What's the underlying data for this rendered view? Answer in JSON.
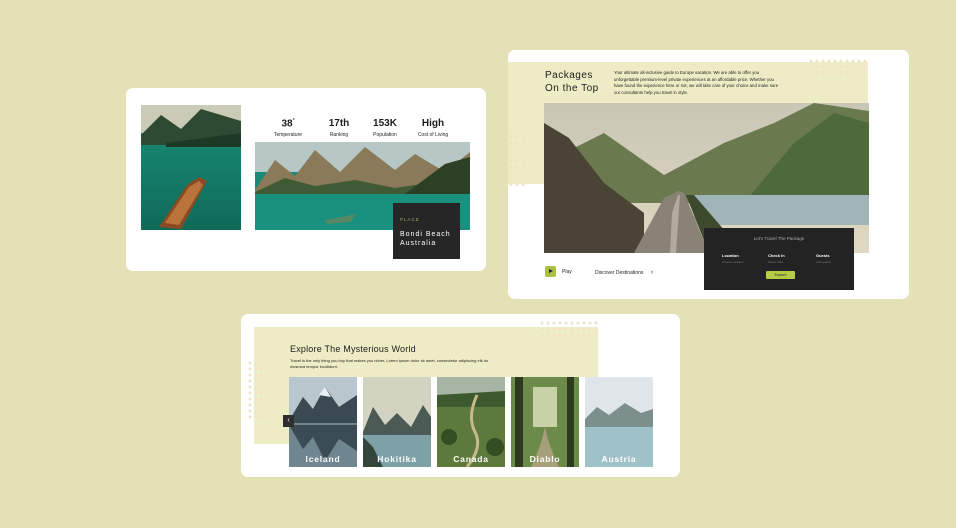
{
  "card1": {
    "stats": [
      {
        "value": "38",
        "unit": "°",
        "label": "Temperature"
      },
      {
        "value": "17th",
        "unit": "",
        "label": "Ranking"
      },
      {
        "value": "153K",
        "unit": "",
        "label": "Population"
      },
      {
        "value": "High",
        "unit": "",
        "label": "Cost of Living"
      }
    ],
    "place_kicker": "PLACE",
    "place_name": "Bondi Beach Australia"
  },
  "card2": {
    "title": "Packages On the Top",
    "description": "Your ultimate all-inclusive guide to Europe vacation. We are able to offer you unforgettable premium-level private experiences at an affordable price. Whether you have found the experience here or not, we will take care of your choice and make sure our consultants help you travel in style.",
    "play_label": "Play",
    "discover_label": "Discover Destinations",
    "discover_arrow": "›",
    "booking": {
      "heading": "Let's Travel The Package",
      "columns": [
        {
          "label": "Location",
          "hint": "Choose location"
        },
        {
          "label": "Check In",
          "hint": "Select date"
        },
        {
          "label": "Guests",
          "hint": "Add guests"
        }
      ],
      "button": "Explore"
    }
  },
  "card3": {
    "title": "Explore The Mysterious World",
    "description": "Travel is the only thing you buy that makes you richer, Lorem ipsum dolor sit amet, consectetur adipiscing elit do eiusmod tempor incididunt.",
    "prev_arrow": "‹",
    "destinations": [
      {
        "name": "Iceland"
      },
      {
        "name": "Hokitika"
      },
      {
        "name": "Canada"
      },
      {
        "name": "Diablo"
      },
      {
        "name": "Austria"
      }
    ]
  },
  "colors": {
    "background": "#e3e1b5",
    "accent": "#b5cc46",
    "band": "#eeecc4",
    "dark_panel": "#232323"
  }
}
